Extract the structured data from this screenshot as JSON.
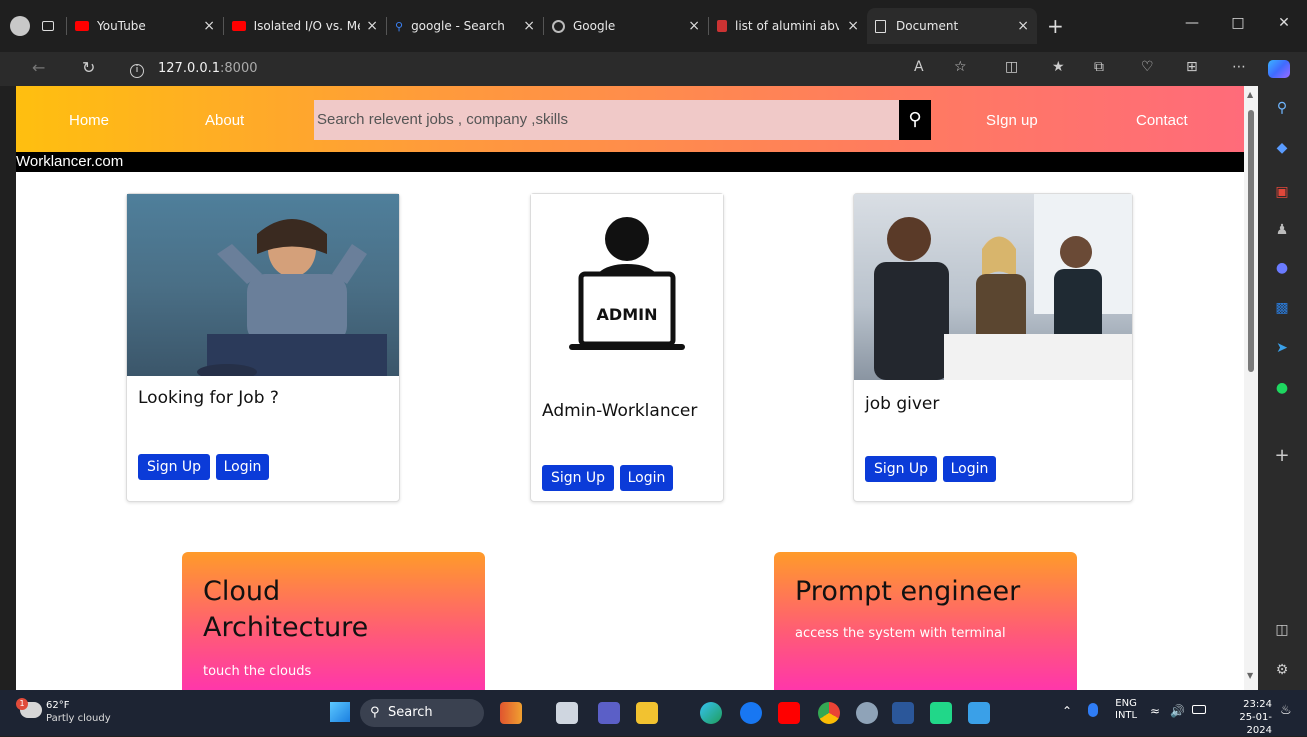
{
  "browser": {
    "tabs": [
      {
        "label": "YouTube",
        "color": "#ff0000"
      },
      {
        "label": "Isolated I/O vs. Me",
        "color": "#ff0000"
      },
      {
        "label": "google - Search",
        "color": "#3b82f6"
      },
      {
        "label": "Google",
        "color": "#888888"
      },
      {
        "label": "list of alumini abvp",
        "color": "#cc3333"
      },
      {
        "label": "Document",
        "color": "#dddddd"
      }
    ],
    "new_tab": "+",
    "close": "×",
    "url_host": "127.0.0.1",
    "url_port": ":8000"
  },
  "page": {
    "nav": {
      "home": "Home",
      "about": "About",
      "search_placeholder": "Search relevent jobs , company ,skills",
      "signup": "SIgn up",
      "contact": "Contact"
    },
    "brand": "Worklancer.com",
    "cards": [
      {
        "title": "Looking for Job ?",
        "signup": "Sign Up",
        "login": "Login"
      },
      {
        "title": "Admin-Worklancer",
        "signup": "Sign Up",
        "login": "Login",
        "image_text": "ADMIN"
      },
      {
        "title": "job giver",
        "signup": "Sign Up",
        "login": "Login"
      }
    ],
    "promos": [
      {
        "title": "Cloud Architecture",
        "subtitle": "touch the clouds"
      },
      {
        "title": "Prompt engineer",
        "subtitle": "access the system with terminal"
      }
    ]
  },
  "taskbar": {
    "weather_temp": "62°F",
    "weather_desc": "Partly cloudy",
    "weather_badge": "1",
    "search": "Search",
    "lang_top": "ENG",
    "lang_bottom": "INTL",
    "time": "23:24",
    "date": "25-01-2024"
  },
  "colors": {
    "nav_gradient_start": "#ffbf0f",
    "nav_gradient_end": "#ff6b7a",
    "button_blue": "#0b3bd8",
    "promo_top": "#ff9b2a",
    "promo_bottom": "#ff2fb5"
  }
}
